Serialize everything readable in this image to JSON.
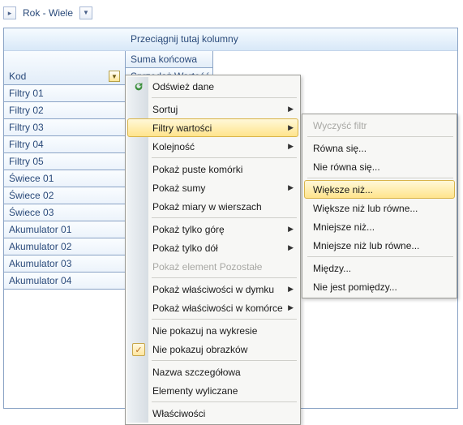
{
  "fieldbar": {
    "label": "Rok - Wiele"
  },
  "dragHint": "Przeciągnij tutaj kolumny",
  "leftHeader": {
    "label": "Kod"
  },
  "rightHeaders": [
    "Suma końcowa",
    "Sprzedaż Wartość"
  ],
  "rows": [
    "Filtry 01",
    "Filtry 02",
    "Filtry 03",
    "Filtry 04",
    "Filtry 05",
    "Świece 01",
    "Świece 02",
    "Świece 03",
    "Akumulator 01",
    "Akumulator 02",
    "Akumulator 03",
    "Akumulator 04"
  ],
  "menu1": {
    "refresh": "Odśwież dane",
    "sort": "Sortuj",
    "valueFilters": "Filtry wartości",
    "order": "Kolejność",
    "showEmpty": "Pokaż puste komórki",
    "showSums": "Pokaż sumy",
    "measuresRows": "Pokaż miary w wierszach",
    "showTop": "Pokaż tylko górę",
    "showBottom": "Pokaż tylko dół",
    "showRest": "Pokaż element Pozostałe",
    "propsTooltip": "Pokaż właściwości w dymku",
    "propsCell": "Pokaż właściwości w komórce",
    "hideChart": "Nie pokazuj na wykresie",
    "hideImages": "Nie pokazuj obrazków",
    "detailName": "Nazwa szczegółowa",
    "calcElems": "Elementy wyliczane",
    "properties": "Właściwości"
  },
  "menu2": {
    "clear": "Wyczyść filtr",
    "eq": "Równa się...",
    "neq": "Nie równa się...",
    "gt": "Większe niż...",
    "gte": "Większe niż lub równe...",
    "lt": "Mniejsze niż...",
    "lte": "Mniejsze niż lub równe...",
    "between": "Między...",
    "notBetween": "Nie jest pomiędzy..."
  }
}
